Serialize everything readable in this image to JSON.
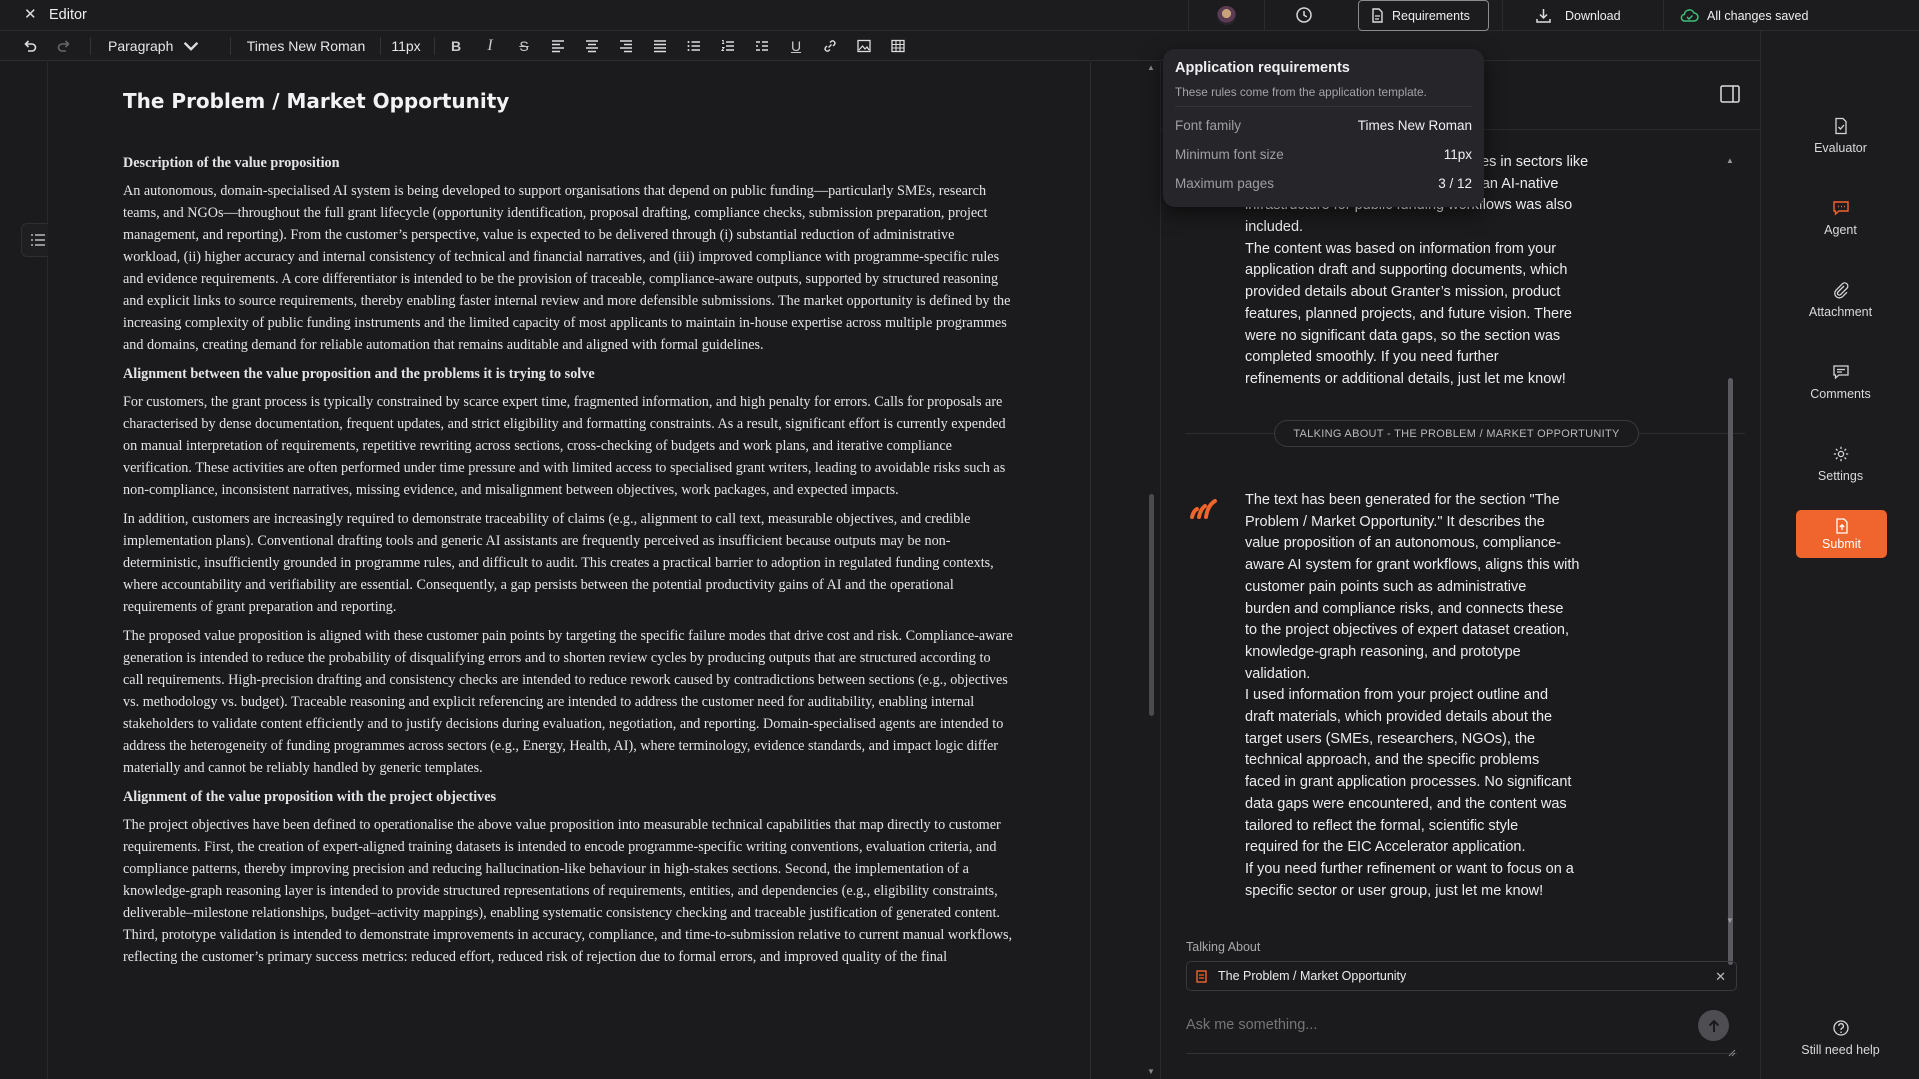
{
  "topbar": {
    "title": "Editor",
    "requirements_label": "Requirements",
    "download_label": "Download",
    "save_status": "All changes saved"
  },
  "toolbar": {
    "block_type": "Paragraph",
    "font_family": "Times New Roman",
    "font_size": "11px"
  },
  "document": {
    "title": "The Problem / Market Opportunity",
    "sections": [
      {
        "heading": "Description of the value proposition",
        "paragraphs": [
          "An autonomous, domain-specialised AI system is being developed to support organisations that depend on public funding—particularly SMEs, research teams, and NGOs—throughout the full grant lifecycle (opportunity identification, proposal drafting, compliance checks, submission preparation, project management, and reporting). From the customer’s perspective, value is expected to be delivered through (i) substantial reduction of administrative workload, (ii) higher accuracy and internal consistency of technical and financial narratives, and (iii) improved compliance with programme-specific rules and evidence requirements. A core differentiator is intended to be the provision of traceable, compliance-aware outputs, supported by structured reasoning and explicit links to source requirements, thereby enabling faster internal review and more defensible submissions. The market opportunity is defined by the increasing complexity of public funding instruments and the limited capacity of most applicants to maintain in-house expertise across multiple programmes and domains, creating demand for reliable automation that remains auditable and aligned with formal guidelines."
        ]
      },
      {
        "heading": "Alignment between the value proposition and the problems it is trying to solve",
        "paragraphs": [
          "For customers, the grant process is typically constrained by scarce expert time, fragmented information, and high penalty for errors. Calls for proposals are characterised by dense documentation, frequent updates, and strict eligibility and formatting constraints. As a result, significant effort is currently expended on manual interpretation of requirements, repetitive rewriting across sections, cross-checking of budgets and work plans, and iterative compliance verification. These activities are often performed under time pressure and with limited access to specialised grant writers, leading to avoidable risks such as non-compliance, inconsistent narratives, missing evidence, and misalignment between objectives, work packages, and expected impacts.",
          "In addition, customers are increasingly required to demonstrate traceability of claims (e.g., alignment to call text, measurable objectives, and credible implementation plans). Conventional drafting tools and generic AI assistants are frequently perceived as insufficient because outputs may be non-deterministic, insufficiently grounded in programme rules, and difficult to audit. This creates a practical barrier to adoption in regulated funding contexts, where accountability and verifiability are essential. Consequently, a gap persists between the potential productivity gains of AI and the operational requirements of grant preparation and reporting.",
          "The proposed value proposition is aligned with these customer pain points by targeting the specific failure modes that drive cost and risk. Compliance-aware generation is intended to reduce the probability of disqualifying errors and to shorten review cycles by producing outputs that are structured according to call requirements. High-precision drafting and consistency checks are intended to reduce rework caused by contradictions between sections (e.g., objectives vs. methodology vs. budget). Traceable reasoning and explicit referencing are intended to address the customer need for auditability, enabling internal stakeholders to validate content efficiently and to justify decisions during evaluation, negotiation, and reporting. Domain-specialised agents are intended to address the heterogeneity of funding programmes across sectors (e.g., Energy, Health, AI), where terminology, evidence standards, and impact logic differ materially and cannot be reliably handled by generic templates."
        ]
      },
      {
        "heading": "Alignment of the value proposition with the project objectives",
        "paragraphs": [
          "The project objectives have been defined to operationalise the above value proposition into measurable technical capabilities that map directly to customer requirements. First, the creation of expert-aligned training datasets is intended to encode programme-specific writing conventions, evaluation criteria, and compliance patterns, thereby improving precision and reducing hallucination-like behaviour in high-stakes sections. Second, the implementation of a knowledge-graph reasoning layer is intended to provide structured representations of requirements, entities, and dependencies (e.g., eligibility constraints, deliverable–milestone relationships, budget–activity mappings), enabling systematic consistency checking and traceable justification of generated content. Third, prototype validation is intended to demonstrate improvements in accuracy, compliance, and time-to-submission relative to current manual workflows, reflecting the customer’s primary success metrics: reduced effort, reduced risk of rejection due to formal errors, and improved quality of the final"
        ]
      }
    ]
  },
  "requirements_popup": {
    "title": "Application requirements",
    "subtitle": "These rules come from the application template.",
    "rows": [
      {
        "label": "Font family",
        "value": "Times New Roman"
      },
      {
        "label": "Minimum font size",
        "value": "11px"
      },
      {
        "label": "Maximum pages",
        "value": "3 / 12"
      }
    ]
  },
  "chat": {
    "prev_message_tail_visible": [
      "oes in sectors like",
      "r an AI-native",
      "infrastructure for public funding workflows was also"
    ],
    "prev_message_lines": [
      "included.",
      "The content was based on information from your",
      "application draft and supporting documents, which",
      "provided details about Granter’s mission, product",
      "features, planned projects, and future vision. There",
      "were no significant data gaps, so the section was",
      "completed smoothly. If you need further",
      "refinements or additional details, just let me know!"
    ],
    "divider_label": "TALKING ABOUT - THE PROBLEM / MARKET OPPORTUNITY",
    "message_lines": [
      "The text has been generated for the section \"The",
      "Problem / Market Opportunity.\" It describes the",
      "value proposition of an autonomous, compliance-",
      "aware AI system for grant workflows, aligns this with",
      "customer pain points such as administrative",
      "burden and compliance risks, and connects these",
      "to the project objectives of expert dataset creation,",
      "knowledge-graph reasoning, and prototype",
      "validation.",
      "I used information from your project outline and",
      "draft materials, which provided details about the",
      "target users (SMEs, researchers, NGOs), the",
      "technical approach, and the specific problems",
      "faced in grant application processes. No significant",
      "data gaps were encountered, and the content was",
      "tailored to reflect the formal, scientific style",
      "required for the EIC Accelerator application.",
      "If you need further refinement or want to focus on a",
      "specific sector or user group, just let me know!"
    ],
    "talking_about_label": "Talking About",
    "talking_about_value": "The Problem / Market Opportunity",
    "input_placeholder": "Ask me something..."
  },
  "rail": {
    "items": [
      {
        "label": "Evaluator",
        "icon": "document-check-icon"
      },
      {
        "label": "Agent",
        "icon": "chat-bubble-icon"
      },
      {
        "label": "Attachment",
        "icon": "paperclip-icon"
      },
      {
        "label": "Comments",
        "icon": "comment-icon"
      },
      {
        "label": "Settings",
        "icon": "gear-icon"
      }
    ],
    "submit_label": "Submit",
    "help_label": "Still need help"
  },
  "colors": {
    "accent": "#f0642d",
    "background": "#1b1b1d",
    "panel": "#1c1c1f"
  }
}
